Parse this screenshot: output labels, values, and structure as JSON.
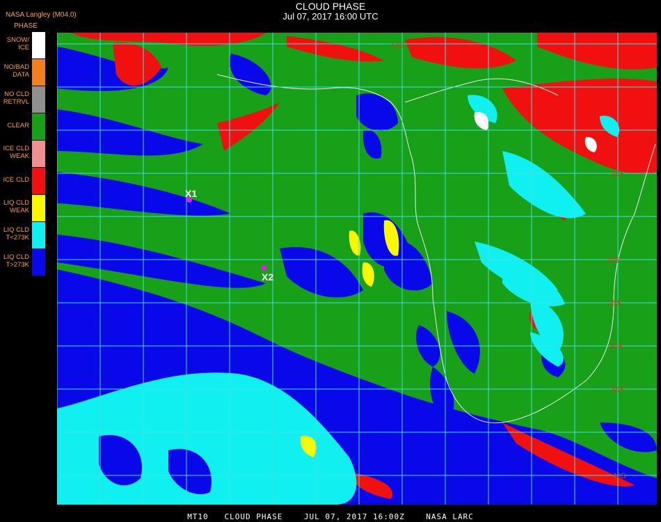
{
  "header": {
    "title": "CLOUD PHASE",
    "subtitle": "Jul 07, 2017 16:00 UTC",
    "org": "NASA Langley (M04.0)"
  },
  "legend": {
    "title": "PHASE",
    "items": [
      {
        "label": "SNOW/\nICE",
        "color": "#ffffff"
      },
      {
        "label": "NO/BAD\nDATA",
        "color": "#f08020"
      },
      {
        "label": "NO CLD\nRETRVL",
        "color": "#909090"
      },
      {
        "label": "CLEAR",
        "color": "#18a018"
      },
      {
        "label": "ICE CLD\nWEAK",
        "color": "#f09090"
      },
      {
        "label": "ICE CLD",
        "color": "#f01010"
      },
      {
        "label": "LIQ CLD\nWEAK",
        "color": "#f8f800"
      },
      {
        "label": "LIQ CLD\nT<273K",
        "color": "#10f0f0"
      },
      {
        "label": "LIQ CLD\nT>273K",
        "color": "#0808e8"
      }
    ]
  },
  "markers": [
    {
      "label": "X1"
    },
    {
      "label": "X2"
    }
  ],
  "lat_labels": [
    "10S",
    "15S",
    "20S",
    "25S",
    "30S",
    "35S",
    "40S"
  ],
  "footer": "MT10   CLOUD PHASE    JUL 07, 2017 16:00Z    NASA LARC",
  "colors": {
    "clear": "#18a018",
    "ice": "#f01010",
    "liq_warm": "#0808e8",
    "liq_cold": "#10f0f0",
    "liq_weak": "#f8f800",
    "grid": "#40e0e0",
    "marker": "#e020e0"
  }
}
